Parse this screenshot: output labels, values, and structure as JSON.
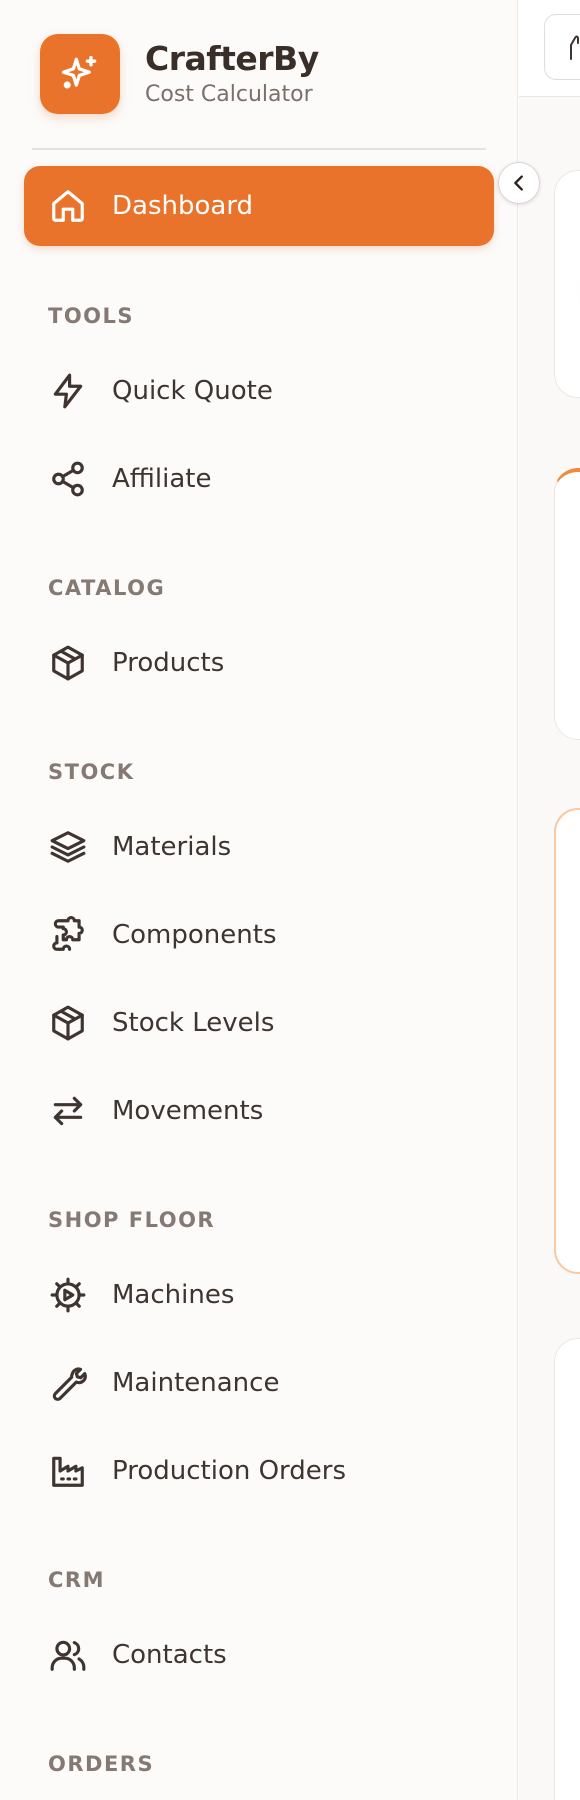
{
  "brand": {
    "name": "CrafterBy",
    "subtitle": "Cost Calculator",
    "icon": "sparkles-icon",
    "accent_color": "#e9732b"
  },
  "nav": {
    "active": {
      "label": "Dashboard",
      "icon": "home-icon"
    },
    "sections": [
      {
        "title": "TOOLS",
        "items": [
          {
            "label": "Quick Quote",
            "icon": "lightning-icon"
          },
          {
            "label": "Affiliate",
            "icon": "share-icon"
          }
        ]
      },
      {
        "title": "CATALOG",
        "items": [
          {
            "label": "Products",
            "icon": "box-icon"
          }
        ]
      },
      {
        "title": "STOCK",
        "items": [
          {
            "label": "Materials",
            "icon": "layers-icon"
          },
          {
            "label": "Components",
            "icon": "puzzle-icon"
          },
          {
            "label": "Stock Levels",
            "icon": "box-icon"
          },
          {
            "label": "Movements",
            "icon": "arrows-exchange-icon"
          }
        ]
      },
      {
        "title": "SHOP FLOOR",
        "items": [
          {
            "label": "Machines",
            "icon": "gear-play-icon"
          },
          {
            "label": "Maintenance",
            "icon": "wrench-icon"
          },
          {
            "label": "Production Orders",
            "icon": "factory-icon"
          }
        ]
      },
      {
        "title": "CRM",
        "items": [
          {
            "label": "Contacts",
            "icon": "users-icon"
          }
        ]
      },
      {
        "title": "ORDERS",
        "items": []
      }
    ]
  }
}
